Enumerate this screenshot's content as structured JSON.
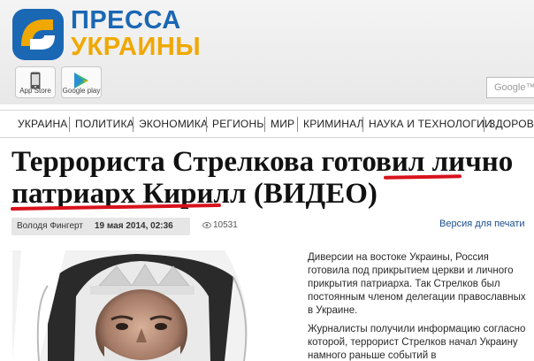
{
  "logo": {
    "line1": "ПРЕССА",
    "line2": "УКРАИНЫ"
  },
  "stores": {
    "appstore_label": "App Store",
    "gplay_label": "Google play"
  },
  "search": {
    "placeholder": "Google™"
  },
  "nav": {
    "items": [
      "УКРАИНА",
      "ПОЛИТИКА",
      "ЭКОНОМИКА",
      "РЕГИОНЫ",
      "МИР",
      "КРИМИНАЛ",
      "НАУКА И ТЕХНОЛОГИИ",
      "ЗДОРОВЬ"
    ]
  },
  "article": {
    "title_line1": "Террориста Стрелкова готовил лично",
    "title_line2": "патриарх Кирилл (ВИДЕО)",
    "author": "Володя Фингерт",
    "date": "19 мая 2014, 02:36",
    "views": "10531",
    "print_label": "Версия для печати",
    "paragraph1": "Диверсии на востоке Украины, Россия готовила под прикрытием церкви и личного прикрытия патриарха. Так Стрелков был постоянным членом делегации православных в Украине.",
    "paragraph2": "Журналисты получили информацию согласно которой, террорист Стрелков начал Украину намного раньше событий в"
  },
  "colors": {
    "logo_blue": "#1a67b4",
    "logo_orange": "#f0a800",
    "underline_red": "#d8121c",
    "link_blue": "#1a4e8c"
  }
}
